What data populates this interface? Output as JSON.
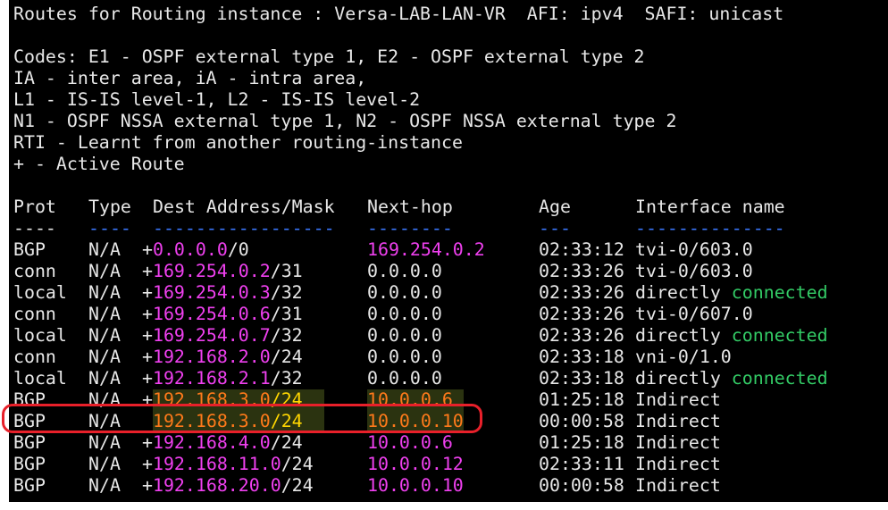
{
  "title_line": "Routes for Routing instance : Versa-LAB-LAN-VR  AFI: ipv4  SAFI: unicast",
  "codes": [
    "Codes: E1 - OSPF external type 1, E2 - OSPF external type 2",
    "IA - inter area, iA - intra area,",
    "L1 - IS-IS level-1, L2 - IS-IS level-2",
    "N1 - OSPF NSSA external type 1, N2 - OSPF NSSA external type 2",
    "RTI - Learnt from another routing-instance",
    "+ - Active Route"
  ],
  "headers": {
    "prot": "Prot",
    "type": "Type",
    "dest": "Dest Address/Mask",
    "nexthop": "Next-hop",
    "age": "Age",
    "iface": "Interface name"
  },
  "dashes": {
    "prot": "----",
    "type": "----",
    "dest": "-----------------",
    "nexthop": "--------",
    "age": "---",
    "iface": "--------------"
  },
  "routes": [
    {
      "prot": "BGP",
      "type": "N/A",
      "flag": "+",
      "addr": "0.0.0.0",
      "mask": "/0",
      "nexthop": "169.254.0.2",
      "age": "02:33:12",
      "iface": "tvi-0/603.0",
      "iface_extra": ""
    },
    {
      "prot": "conn",
      "type": "N/A",
      "flag": "+",
      "addr": "169.254.0.2",
      "mask": "/31",
      "nexthop": "0.0.0.0",
      "age": "02:33:26",
      "iface": "tvi-0/603.0",
      "iface_extra": ""
    },
    {
      "prot": "local",
      "type": "N/A",
      "flag": "+",
      "addr": "169.254.0.3",
      "mask": "/32",
      "nexthop": "0.0.0.0",
      "age": "02:33:26",
      "iface": "directly",
      "iface_extra": "connected"
    },
    {
      "prot": "conn",
      "type": "N/A",
      "flag": "+",
      "addr": "169.254.0.6",
      "mask": "/31",
      "nexthop": "0.0.0.0",
      "age": "02:33:26",
      "iface": "tvi-0/607.0",
      "iface_extra": ""
    },
    {
      "prot": "local",
      "type": "N/A",
      "flag": "+",
      "addr": "169.254.0.7",
      "mask": "/32",
      "nexthop": "0.0.0.0",
      "age": "02:33:26",
      "iface": "directly",
      "iface_extra": "connected"
    },
    {
      "prot": "conn",
      "type": "N/A",
      "flag": "+",
      "addr": "192.168.2.0",
      "mask": "/24",
      "nexthop": "0.0.0.0",
      "age": "02:33:18",
      "iface": "vni-0/1.0",
      "iface_extra": ""
    },
    {
      "prot": "local",
      "type": "N/A",
      "flag": "+",
      "addr": "192.168.2.1",
      "mask": "/32",
      "nexthop": "0.0.0.0",
      "age": "02:33:18",
      "iface": "directly",
      "iface_extra": "connected"
    },
    {
      "prot": "BGP",
      "type": "N/A",
      "flag": "+",
      "addr": "192.168.3.0",
      "mask": "/24",
      "nexthop": "10.0.0.6",
      "age": "01:25:18",
      "iface": "Indirect",
      "iface_extra": ""
    },
    {
      "prot": "BGP",
      "type": "N/A",
      "flag": " ",
      "addr": "192.168.3.0",
      "mask": "/24",
      "nexthop": "10.0.0.10",
      "age": "00:00:58",
      "iface": "Indirect",
      "iface_extra": ""
    },
    {
      "prot": "BGP",
      "type": "N/A",
      "flag": "+",
      "addr": "192.168.4.0",
      "mask": "/24",
      "nexthop": "10.0.0.6",
      "age": "01:25:18",
      "iface": "Indirect",
      "iface_extra": ""
    },
    {
      "prot": "BGP",
      "type": "N/A",
      "flag": "+",
      "addr": "192.168.11.0",
      "mask": "/24",
      "nexthop": "10.0.0.12",
      "age": "02:33:11",
      "iface": "Indirect",
      "iface_extra": ""
    },
    {
      "prot": "BGP",
      "type": "N/A",
      "flag": "+",
      "addr": "192.168.20.0",
      "mask": "/24",
      "nexthop": "10.0.0.10",
      "age": "00:00:58",
      "iface": "Indirect",
      "iface_extra": ""
    }
  ],
  "colors": {
    "background": "#000000",
    "text": "#e8e8e8",
    "address": "#f040f0",
    "connected": "#33cc66",
    "dash_underline": "#3b78ff",
    "highlight_mask": "#ffd600",
    "highlight_address": "#ff7a1a",
    "annotation_circle": "#e8202a"
  }
}
